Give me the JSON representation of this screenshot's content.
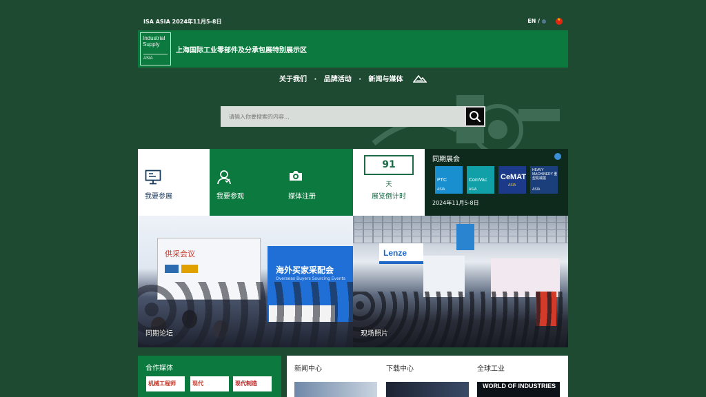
{
  "topbar": {
    "event_info": "ISA ASIA 2024年11月5-8日",
    "lang": "EN /"
  },
  "banner": {
    "logo_line1": "Industrial",
    "logo_line2": "Supply",
    "logo_sub": "ASIA",
    "title": "上海国际工业零部件及分承包展特别展示区"
  },
  "nav": {
    "items": [
      "关于我们",
      "品牌活动",
      "新闻与媒体"
    ],
    "separator": "·"
  },
  "search": {
    "placeholder": "请输入你要搜索的内容..."
  },
  "tiles": {
    "exhibit": "我要参展",
    "visit": "我要参观",
    "media": "媒体注册",
    "countdown_value": "91",
    "countdown_unit": "天",
    "countdown_label": "展览倒计时"
  },
  "concurrent": {
    "title": "同期展会",
    "shows": [
      {
        "name": "PTC",
        "sub": "ASIA"
      },
      {
        "name": "ComVac",
        "sub": "ASIA"
      },
      {
        "name": "CeMAT",
        "sub": "ASIA"
      },
      {
        "name": "HEAVY MACHINERY 重型机械展",
        "sub": "ASIA"
      }
    ],
    "date": "2024年11月5-8日"
  },
  "photos": {
    "forum_caption": "同期论坛",
    "forum_screen_title": "供采会议",
    "forum_screen2_title": "海外买家采配会",
    "forum_screen2_sub": "Overseas Buyers Sourcing Events",
    "hall_caption": "现场照片",
    "hall_brand": "Lenze"
  },
  "media": {
    "title": "合作媒体",
    "logos": [
      "机械工程师",
      "现代",
      "现代制造"
    ]
  },
  "panels": {
    "news": "新闻中心",
    "downloads": "下载中心",
    "global": "全球工业",
    "global_thumb": "WORLD OF INDUSTRIES"
  },
  "colors": {
    "background": "#1e4a32",
    "brand_green": "#0c7a3e",
    "dark_panel": "#0e2a1c"
  }
}
